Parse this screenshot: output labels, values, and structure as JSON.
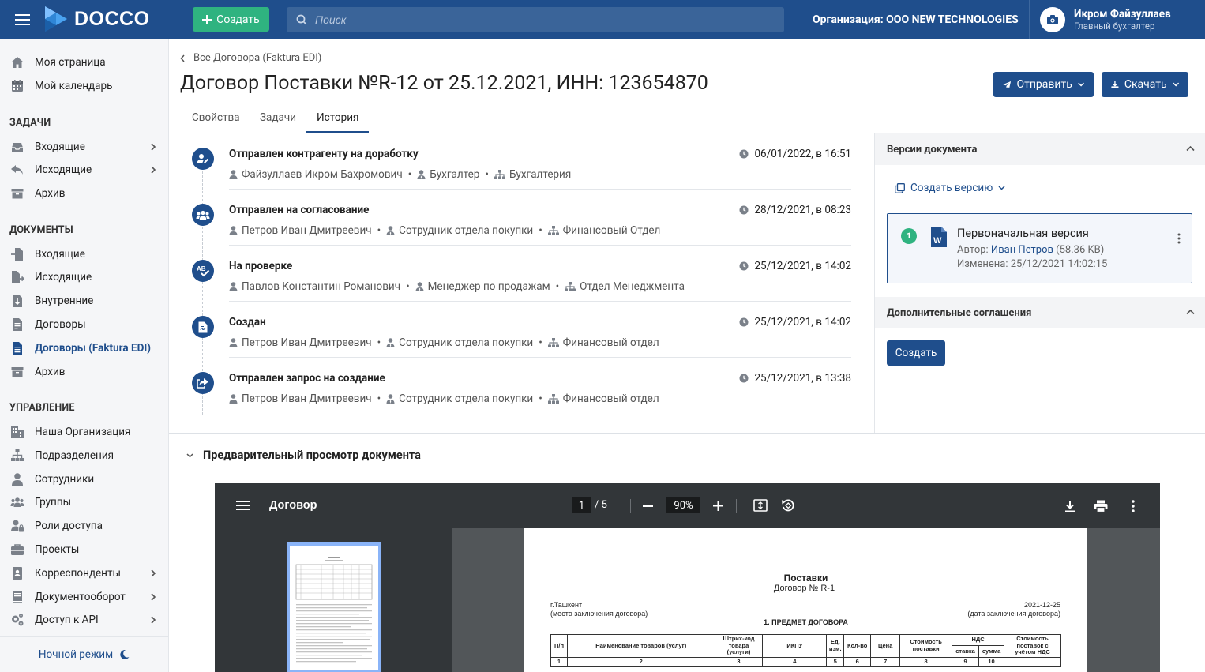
{
  "topbar": {
    "logo_text": "DOCCO",
    "create_label": "Создать",
    "search_placeholder": "Поиск",
    "organization": "Организация: ООО NEW TECHNOLOGIES",
    "user_name": "Икром Файзуллаев",
    "user_role": "Главный бухгалтер"
  },
  "sidebar": {
    "top_items": [
      {
        "label": "Моя страница",
        "icon": "home-icon"
      },
      {
        "label": "Мой календарь",
        "icon": "calendar-icon"
      }
    ],
    "sections": [
      {
        "title": "ЗАДАЧИ",
        "items": [
          {
            "label": "Входящие",
            "icon": "inbox-icon",
            "expandable": true
          },
          {
            "label": "Исходящие",
            "icon": "reply-icon",
            "expandable": true
          },
          {
            "label": "Архив",
            "icon": "archive-icon",
            "expandable": false
          }
        ]
      },
      {
        "title": "ДОКУМЕНТЫ",
        "items": [
          {
            "label": "Входящие",
            "icon": "file-import-icon",
            "expandable": false
          },
          {
            "label": "Исходящие",
            "icon": "file-export-icon",
            "expandable": false
          },
          {
            "label": "Внутренние",
            "icon": "file-download-icon",
            "expandable": false
          },
          {
            "label": "Договоры",
            "icon": "file-contract-icon",
            "expandable": false
          },
          {
            "label": "Договоры (Faktura EDI)",
            "icon": "file-text-icon",
            "expandable": false,
            "active": true
          },
          {
            "label": "Архив",
            "icon": "archive-icon",
            "expandable": false
          }
        ]
      },
      {
        "title": "УПРАВЛЕНИЕ",
        "items": [
          {
            "label": "Наша Организация",
            "icon": "building-icon",
            "expandable": false
          },
          {
            "label": "Подразделения",
            "icon": "sitemap-icon",
            "expandable": false
          },
          {
            "label": "Сотрудники",
            "icon": "user-icon",
            "expandable": false
          },
          {
            "label": "Группы",
            "icon": "users-icon",
            "expandable": false
          },
          {
            "label": "Роли доступа",
            "icon": "user-lock-icon",
            "expandable": false
          },
          {
            "label": "Проекты",
            "icon": "briefcase-icon",
            "expandable": false
          },
          {
            "label": "Корреспонденты",
            "icon": "address-book-icon",
            "expandable": true
          },
          {
            "label": "Документооборот",
            "icon": "book-icon",
            "expandable": true
          },
          {
            "label": "Доступ к API",
            "icon": "cogs-icon",
            "expandable": true
          }
        ]
      }
    ],
    "night_mode": "Ночной режим"
  },
  "page": {
    "breadcrumb": "Все Договора (Faktura EDI)",
    "title": "Договор Поставки №R-12 от 25.12.2021, ИНН: 123654870",
    "send_label": "Отправить",
    "download_label": "Скачать",
    "tabs": [
      "Свойства",
      "Задачи",
      "История"
    ],
    "active_tab": "История"
  },
  "history": [
    {
      "title": "Отправлен контрагенту на доработку",
      "date": "06/01/2022, в 16:51",
      "person": "Файзуллаев Икром Бахромович",
      "role": "Бухгалтер",
      "dept": "Бухгалтерия",
      "icon": "user-edit-icon"
    },
    {
      "title": "Отправлен на согласование",
      "date": "28/12/2021, в 08:23",
      "person": "Петров Иван Дмитреевич",
      "role": "Сотрудник отдела покупки",
      "dept": "Финансовый Отдел",
      "icon": "users-icon"
    },
    {
      "title": "На проверке",
      "date": "25/12/2021, в 14:02",
      "person": "Павлов Константин Романович",
      "role": "Менеджер по продажам",
      "dept": "Отдел Менеджмента",
      "icon": "spell-check-icon"
    },
    {
      "title": "Создан",
      "date": "25/12/2021, в 14:02",
      "person": "Петров Иван Дмитреевич",
      "role": "Сотрудник отдела покупки",
      "dept": "Финансовый отдел",
      "icon": "file-signature-icon"
    },
    {
      "title": "Отправлен запрос на создание",
      "date": "25/12/2021, в 13:38",
      "person": "Петров Иван Дмитреевич",
      "role": "Сотрудник отдела покупки",
      "dept": "Финансовый отдел",
      "icon": "share-square-icon"
    }
  ],
  "versions": {
    "title": "Версии документа",
    "create_version": "Создать версию",
    "card": {
      "number": "1",
      "name": "Первоначальная версия",
      "author_label": "Автор:",
      "author": "Иван Петров",
      "size": "(58.36 KB)",
      "modified": "Изменена: 25/12/2021 14:02:15"
    },
    "agreements_title": "Дополнительные соглашения",
    "create_label": "Создать"
  },
  "preview": {
    "title": "Предварительный просмотр документа",
    "viewer_title": "Договор",
    "page_current": "1",
    "page_total": "/  5",
    "zoom": "90%",
    "doc": {
      "heading": "Поставки",
      "subheading": "Договор № R-1",
      "city": "г.Ташкент",
      "city_note": "(место заключения договора)",
      "date": "2021-12-25",
      "date_note": "(дата заключения договора)",
      "section": "1. ПРЕДМЕТ ДОГОВОРА",
      "table_headers": [
        "П/п",
        "Наименование товаров (услуг)",
        "Штрих-код товара (услуги)",
        "ИКПУ",
        "Ед. изм.",
        "Кол-во",
        "Цена",
        "Стоимость поставки",
        "НДС",
        "Стоимость поставок с учётом НДС"
      ],
      "vat_sub": [
        "ставка",
        "сумма"
      ],
      "table_numbers": [
        "1",
        "2",
        "3",
        "4",
        "5",
        "6",
        "7",
        "8",
        "9",
        "10"
      ]
    }
  },
  "colors": {
    "primary": "#1f4e8c",
    "accent_green": "#2fb380"
  }
}
